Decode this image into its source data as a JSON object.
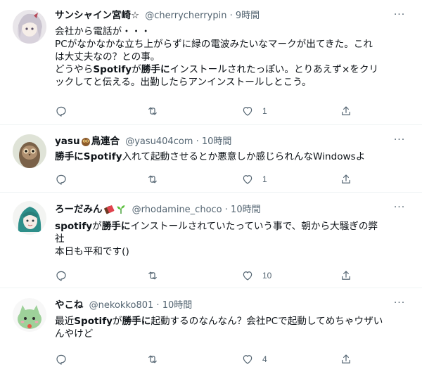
{
  "tweets": [
    {
      "name": "サンシャイン宮崎☆",
      "handle": "@cherrycherrypin",
      "sep": "·",
      "time": "9時間",
      "lines": [
        "会社から電話が・・・",
        "PCがなかなかな立ち上がらずに緑の電波みたいなマークが出てきた。これ",
        "は大丈夫なの？との事。"
      ],
      "line4_pre": "どうやら",
      "line4_b1": "Spotify",
      "line4_mid": "が",
      "line4_b2": "勝手に",
      "line4_post": "インストールされたっぽい。とりあえず×をクリ",
      "line5": "ックしてと伝える。出勤したらアンインストールしとこう。",
      "likes": "1"
    },
    {
      "name": "yasu",
      "name2": "鳥連合",
      "handle": "@yasu404com",
      "sep": "·",
      "time": "10時間",
      "b1": "勝手に",
      "b2": "Spotify",
      "post": "入れて起動させるとか悪意しか感じられんなWindowsよ",
      "likes": "1"
    },
    {
      "name": "ろーだみん",
      "handle": "@rhodamine_choco",
      "sep": "·",
      "time": "10時間",
      "b1": "spotify",
      "mid": "が",
      "b2": "勝手に",
      "post": "インストールされていたっていう事で、朝から大騒ぎの弊",
      "line2": "社",
      "line3": "本日も平和です()",
      "likes": "10"
    },
    {
      "name": "やこね",
      "handle": "@nekokko801",
      "sep": "·",
      "time": "10時間",
      "pre": "最近",
      "b1": "Spotify",
      "mid": "が",
      "b2": "勝手に",
      "post": "起動するのなんなん？会社PCで起動してめちゃウザい",
      "line2": "んやけど",
      "likes": "4"
    }
  ],
  "colors": {
    "text": "#0f1419",
    "muted": "#536471",
    "divider": "#eff3f4"
  },
  "icons": {
    "more": "more-icon",
    "reply": "reply-icon",
    "retweet": "retweet-icon",
    "like": "like-icon",
    "share": "share-icon"
  }
}
